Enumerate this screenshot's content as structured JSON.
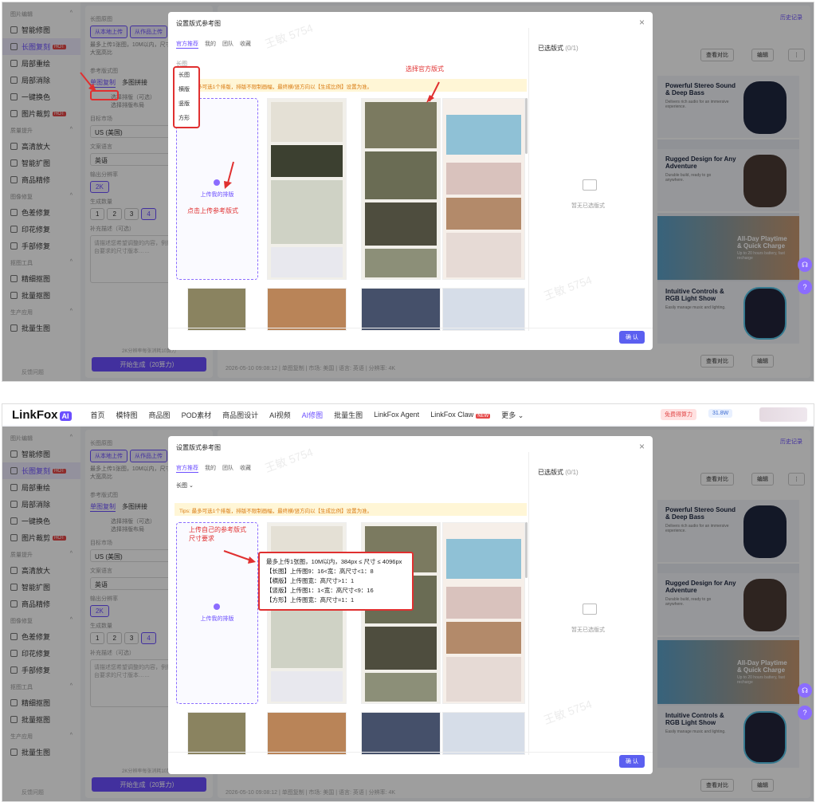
{
  "sidebar": {
    "sections": [
      {
        "title": "图片编辑",
        "items": [
          {
            "label": "智能修图",
            "hot": false
          },
          {
            "label": "长图复刻",
            "hot": true,
            "active": true
          },
          {
            "label": "局部重绘",
            "hot": false
          },
          {
            "label": "局部消除",
            "hot": false
          },
          {
            "label": "一键换色",
            "hot": false
          },
          {
            "label": "图片裁剪",
            "hot": true
          }
        ]
      },
      {
        "title": "质量提升",
        "items": [
          {
            "label": "高清放大"
          },
          {
            "label": "智能扩图"
          },
          {
            "label": "商品精修"
          }
        ]
      },
      {
        "title": "图像修复",
        "items": [
          {
            "label": "色差修复"
          },
          {
            "label": "印花修复"
          },
          {
            "label": "手部修复"
          }
        ]
      },
      {
        "title": "抠图工具",
        "items": [
          {
            "label": "精细抠图"
          },
          {
            "label": "批量抠图"
          }
        ]
      },
      {
        "title": "生产应用",
        "items": [
          {
            "label": "批量生图"
          }
        ]
      }
    ],
    "hot_label": "HOT",
    "footer": "反馈问题"
  },
  "config": {
    "section_label": "长图原图",
    "upload_btn": "从本地上传",
    "other_btn": "从作品上传",
    "upload_desc": "最多上传1张图，10M以内，尺寸 ≤ 4096px，最大宽高比",
    "mode_label": "参考版式图",
    "tab_single": "单图复制",
    "tab_multi": "多图拼接",
    "select_layout": "选择排版（可选）",
    "select_layout_sub": "选择排版布局",
    "country_label": "目标市场",
    "country": "US (美国)",
    "lang_label": "文案语言",
    "lang": "英语",
    "res_label": "输出分辨率",
    "res": "2K",
    "count_label": "生成数量",
    "counts": [
      "1",
      "2",
      "3",
      "4"
    ],
    "prompt_label": "补充描述（可选）",
    "prompt_placeholder": "请描述您希望调整的内容，例如：修改为平台要求的尺寸版本……",
    "gen_btn": "开始生成（20算力）",
    "gen_note": "2K分辨率每张消耗10算力"
  },
  "main": {
    "history": "历史记录",
    "compare": "查看对比",
    "edit": "编辑",
    "more": "⋮",
    "bottom_meta": "2026-05-10 09:08:12 | 单图复制 | 市场: 美国 | 语言: 英语 | 分辨率: 4K",
    "products": [
      {
        "title": "Powerful Stereo Sound & Deep Bass",
        "sub": "Delivers rich audio for an immersive experience."
      },
      {
        "title": "Rugged Design for Any Adventure",
        "sub": "Durable build, ready to go anywhere."
      },
      {
        "title": "All-Day Playtime & Quick Charge",
        "sub": "Up to 20 hours battery, fast recharge"
      },
      {
        "title": "Intuitive Controls & RGB Light Show",
        "sub": "Easily manage music and lighting."
      }
    ]
  },
  "topnav": {
    "logo": "LinkFox",
    "logo_ai": "AI",
    "items": [
      "首页",
      "模特图",
      "商品图",
      "POD素材",
      "商品图设计",
      "AI视频",
      "AI修图",
      "批量生图",
      "LinkFox Agent",
      "LinkFox Claw",
      "更多"
    ],
    "active": "AI修图",
    "claw_badge": "NEW",
    "free": "免费得算力",
    "credits": "31.8W"
  },
  "modal": {
    "title": "设置版式参考图",
    "close": "×",
    "tabs": [
      "官方推荐",
      "我的",
      "团队",
      "收藏"
    ],
    "dropdown": "长图",
    "dropdown_options": [
      "长图",
      "横版",
      "竖版",
      "方形"
    ],
    "tip": "Tips: 最多可选1个排版，排版不限制画幅，最终横/竖方向以【生成比例】设置为准。",
    "upload_label": "上传我的排版",
    "selected_title": "已选版式",
    "selected_count": "(0/1)",
    "empty": "暂无已选版式",
    "ok": "确 认",
    "watermark": "王敏 5754"
  },
  "annotations": {
    "select_official": "选择官方版式",
    "click_upload": "点击上传参考版式",
    "own_ref": "上传自己的参考版式\n尺寸要求",
    "spec_lines": [
      "最多上传1张图，10M以内，384px ≤ 尺寸 ≤ 4096px",
      "【长图】上传图9：16<宽：高尺寸<1：8",
      "【横版】上传图宽：高尺寸>1：1",
      "【竖版】上传图1：1<宽：高尺寸<9：16",
      "【方形】上传图宽：高尺寸=1：1"
    ]
  },
  "colors": {
    "accent": "#6b4eff",
    "annotation": "#e03030",
    "confirm": "#5b5ff0"
  }
}
